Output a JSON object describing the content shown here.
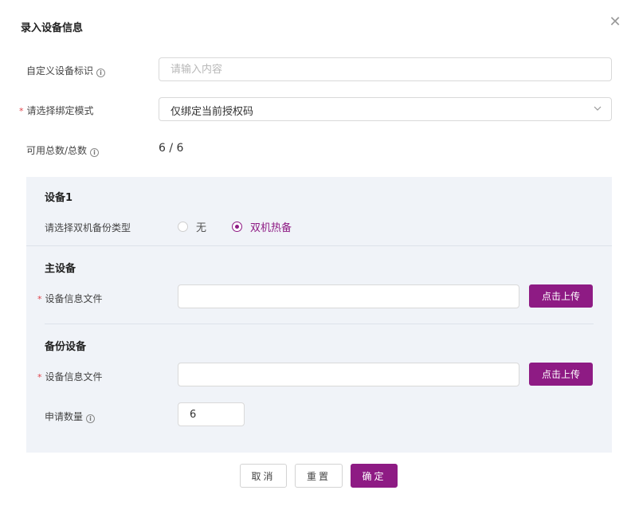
{
  "dialog": {
    "title": "录入设备信息",
    "close_icon": "close-icon"
  },
  "form": {
    "custom_id": {
      "label": "自定义设备标识",
      "placeholder": "请输入内容",
      "value": ""
    },
    "bind_mode": {
      "required": "*",
      "label": "请选择绑定模式",
      "selected": "仅绑定当前授权码"
    },
    "count": {
      "label": "可用总数/总数",
      "value": "6 / 6"
    }
  },
  "device": {
    "title": "设备1",
    "backup_type": {
      "label": "请选择双机备份类型",
      "options": [
        {
          "label": "无",
          "checked": false
        },
        {
          "label": "双机热备",
          "checked": true
        }
      ]
    },
    "primary": {
      "title": "主设备",
      "file_label": "设备信息文件",
      "required": "*",
      "file_value": "",
      "upload_label": "点击上传"
    },
    "backup": {
      "title": "备份设备",
      "file_label": "设备信息文件",
      "required": "*",
      "file_value": "",
      "upload_label": "点击上传"
    },
    "quantity": {
      "label": "申请数量",
      "value": "6"
    }
  },
  "footer": {
    "cancel_label": "取消",
    "reset_label": "重置",
    "confirm_label": "确定"
  },
  "colors": {
    "accent": "#8e1b84",
    "panel_bg": "#f0f3f8",
    "required": "#e0434a"
  }
}
